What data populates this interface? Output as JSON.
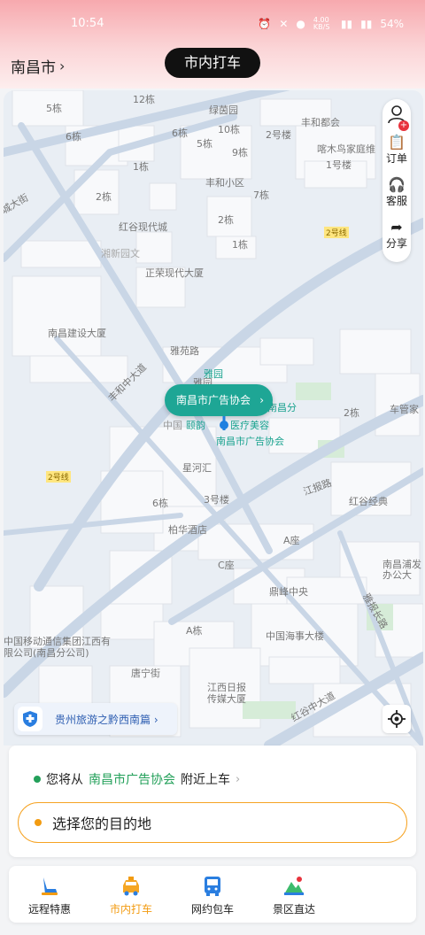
{
  "status_bar": {
    "time": "10:54",
    "network_speed": "4.00 KB/S",
    "battery": "54%"
  },
  "header": {
    "city": "南昌市",
    "active_tab": "市内打车"
  },
  "side_panel": {
    "orders": "订单",
    "service": "客服",
    "share": "分享"
  },
  "map": {
    "pin_label": "南昌市广告协会",
    "labels": {
      "road_1": "丰和中大道",
      "road_2": "雅苑路",
      "road_3": "江报路",
      "road_4": "红谷中大道",
      "road_5": "雅报长路",
      "road_6": "唐宁街",
      "line_2_a": "2号线",
      "line_2_b": "2号线",
      "b_5": "5栋",
      "b_6a": "6栋",
      "b_12": "12栋",
      "b_green": "绿茵园",
      "b_6b": "6栋",
      "b_5b": "5栋",
      "b_10": "10栋",
      "b_2a": "2号楼",
      "b_fh": "丰和都会",
      "b_mall": "喀木鸟家庭维",
      "b_1lou": "1号楼",
      "b_1a": "1栋",
      "b_9": "9栋",
      "b_fhxq": "丰和小区",
      "b_2b": "2栋",
      "b_7": "7栋",
      "b_ave": "城大街",
      "b_hgxd": "红谷现代城",
      "b_xnt": "湘新园文",
      "b_2c": "2栋",
      "b_1b": "1栋",
      "b_zr": "正荣现代大厦",
      "b_ncjs": "南昌建设大厦",
      "b_yy": "雅园",
      "b_yyg": "雅园",
      "b_zhong": "中国",
      "b_yc": "颐韵",
      "b_mr": "医疗美容",
      "b_ncf": "南昌分",
      "b_gg": "南昌市广告协会",
      "b_2d": "2栋",
      "b_cg": "车管家",
      "b_xhh": "星河汇",
      "b_6c": "6栋",
      "b_3": "3号楼",
      "b_hgjd": "红谷经典",
      "b_bh": "柏华酒店",
      "b_aa": "A座",
      "b_cz": "C座",
      "b_ncbg": "南昌浦发办公大",
      "b_dfz": "鼎峰中央",
      "b_cmcc": "中国移动通信集团江西有限公司(南昌分公司)",
      "b_a2": "A栋",
      "b_hs": "中国海事大楼",
      "b_jxrb": "江西日报传媒大厦"
    },
    "promo": "贵州旅游之黔西南篇"
  },
  "card": {
    "pickup_prefix": "您将从",
    "pickup_place": "南昌市广告协会",
    "pickup_suffix": "附近上车",
    "destination": "选择您的目的地"
  },
  "services": [
    {
      "label": "远程特惠"
    },
    {
      "label": "市内打车"
    },
    {
      "label": "网约包车"
    },
    {
      "label": "景区直达"
    }
  ],
  "colors": {
    "accent_green": "#1ea695",
    "accent_orange": "#f29b11",
    "pickup_green": "#23a05a"
  }
}
